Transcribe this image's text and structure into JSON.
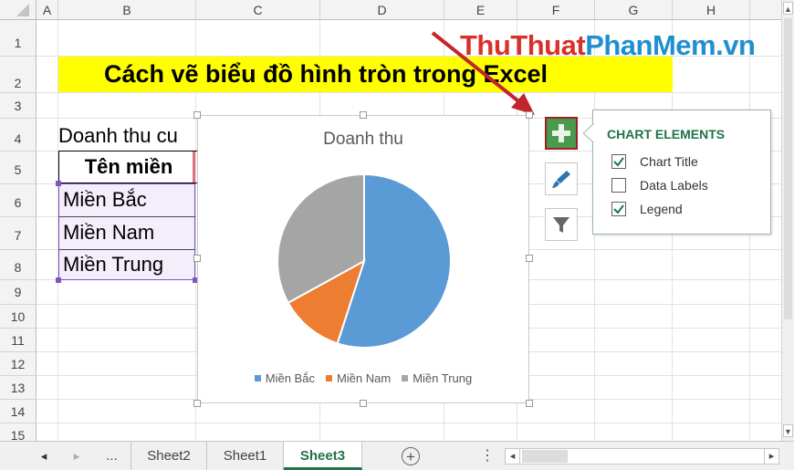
{
  "columns": [
    "A",
    "B",
    "C",
    "D",
    "E",
    "F",
    "G",
    "H"
  ],
  "rows": [
    "1",
    "2",
    "3",
    "4",
    "5",
    "6",
    "7",
    "8",
    "9",
    "10",
    "11",
    "12",
    "13",
    "14",
    "15"
  ],
  "sheet": {
    "title": "Cách vẽ biểu đồ hình tròn trong Excel",
    "a4": "Doanh thu cu",
    "b5_header": "Tên miền",
    "regions": [
      "Miền Bắc",
      "Miền Nam",
      "Miền Trung"
    ]
  },
  "watermark": {
    "part1": "ThuThuat",
    "part2": "PhanMem",
    "part3": ".vn"
  },
  "chart_data": {
    "type": "pie",
    "title": "Doanh thu",
    "categories": [
      "Miền Bắc",
      "Miền Nam",
      "Miền Trung"
    ],
    "values": [
      55,
      12,
      33
    ],
    "colors": [
      "#5b9bd5",
      "#ed7d31",
      "#a5a5a5"
    ],
    "legend": "bottom"
  },
  "chart_elements_panel": {
    "title": "CHART ELEMENTS",
    "items": [
      {
        "label": "Chart Title",
        "checked": true
      },
      {
        "label": "Data Labels",
        "checked": false
      },
      {
        "label": "Legend",
        "checked": true
      }
    ]
  },
  "side_buttons": [
    "chart-elements-icon",
    "chart-styles-icon",
    "chart-filters-icon"
  ],
  "tabs": {
    "ellipsis": "...",
    "items": [
      "Sheet2",
      "Sheet1",
      "Sheet3"
    ],
    "active": "Sheet3",
    "scroll_left": "◂",
    "scroll_right": "▸",
    "prev": "◂",
    "next": "▸",
    "dots": "⋮"
  },
  "colors": {
    "accent": "#217346",
    "title_bg": "#ffff00",
    "watermark_red": "#d9302c",
    "watermark_blue": "#1f8fcf"
  }
}
